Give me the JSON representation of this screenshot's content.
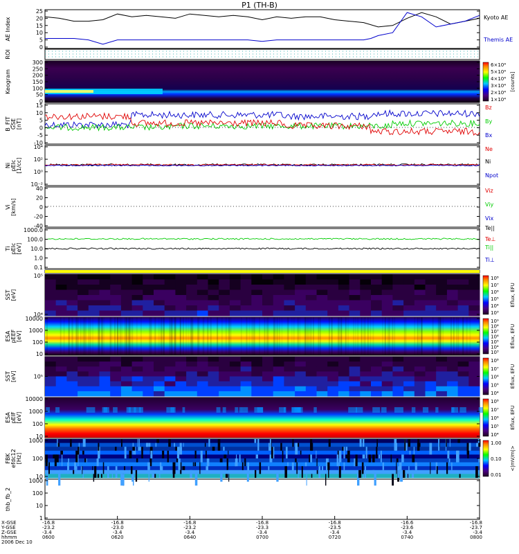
{
  "title": "P1 (TH-B)",
  "colors": {
    "black": "#000000",
    "blue": "#0000cc",
    "red": "#e00000",
    "green": "#00cc00",
    "yellow": "#ffff00",
    "cyan": "#00a0a0",
    "dark_bg": "#1a0020"
  },
  "chart_data": [
    {
      "type": "line",
      "panel": "ae",
      "ylabel": "AE Index",
      "ylim": [
        0,
        25
      ],
      "yticks": [
        "25",
        "20",
        "15",
        "10",
        "5",
        "0"
      ],
      "series": [
        {
          "name": "Kyoto AE",
          "color": "#000000",
          "x": [
            0,
            4,
            8,
            12,
            16,
            20,
            24,
            28,
            32,
            36,
            40,
            44,
            48,
            52,
            56,
            60,
            64,
            68,
            72,
            76,
            80,
            84,
            88,
            92,
            96,
            100,
            104,
            108,
            112,
            116,
            120
          ],
          "y": [
            21,
            20,
            18,
            18,
            19,
            23,
            21,
            22,
            21,
            20,
            23,
            22,
            21,
            22,
            21,
            19,
            21,
            20,
            21,
            21,
            19,
            18,
            17,
            14,
            15,
            20,
            24,
            21,
            16,
            18,
            20
          ]
        },
        {
          "name": "Themis AE",
          "color": "#0000cc",
          "x": [
            0,
            4,
            8,
            12,
            16,
            20,
            24,
            28,
            32,
            36,
            40,
            44,
            48,
            52,
            56,
            60,
            64,
            68,
            72,
            76,
            80,
            84,
            88,
            90,
            92,
            96,
            100,
            104,
            108,
            112,
            116,
            120
          ],
          "y": [
            6,
            6,
            6,
            5,
            2,
            5,
            5,
            5,
            5,
            5,
            5,
            5,
            5,
            5,
            5,
            4,
            5,
            5,
            5,
            5,
            5,
            5,
            5,
            6,
            8,
            10,
            24,
            21,
            14,
            16,
            18,
            22
          ]
        }
      ]
    },
    {
      "type": "line",
      "panel": "roi",
      "ylabel": "ROI"
    },
    {
      "type": "heatmap",
      "panel": "keogram",
      "ylabel": "Keogram",
      "ylim": [
        0,
        300
      ],
      "yticks": [
        "300",
        "250",
        "200",
        "150",
        "100",
        "50",
        "0"
      ],
      "colorbar_ticks": [
        "6×10⁴",
        "5×10⁴",
        "4×10⁴",
        "3×10⁴",
        "2×10⁴",
        "1×10⁴"
      ],
      "colorbar_label": "[counts]"
    },
    {
      "type": "line",
      "panel": "bfield",
      "ylabel": "B_FIT",
      "ylabel2": "GSE",
      "ylabel3": "[nT]",
      "ylim": [
        -10,
        15
      ],
      "yticks": [
        "15",
        "10",
        "5",
        "0",
        "-5",
        "-10"
      ],
      "series": [
        {
          "name": "Bz",
          "color": "#e00000"
        },
        {
          "name": "By",
          "color": "#00cc00"
        },
        {
          "name": "Bx",
          "color": "#0000cc"
        }
      ]
    },
    {
      "type": "line",
      "panel": "density",
      "ylabel": "Ni",
      "ylabel2": "pEIc",
      "ylabel3": "[1/cc]",
      "yticks": [
        "10⁴",
        "10²",
        "10⁰",
        "10⁻²"
      ],
      "series": [
        {
          "name": "Ne",
          "color": "#e00000"
        },
        {
          "name": "Ni",
          "color": "#000000"
        },
        {
          "name": "Npot",
          "color": "#0000cc"
        }
      ]
    },
    {
      "type": "line",
      "panel": "velocity",
      "ylabel": "Vi",
      "ylabel2": "[km/s]",
      "ylim": [
        -50,
        50
      ],
      "yticks": [
        "40",
        "20",
        "0",
        "-20",
        "-40"
      ],
      "series": [
        {
          "name": "Viz",
          "color": "#e00000"
        },
        {
          "name": "Viy",
          "color": "#00cc00"
        },
        {
          "name": "Vix",
          "color": "#0000cc"
        }
      ]
    },
    {
      "type": "line",
      "panel": "temperature",
      "ylabel": "Ti",
      "ylabel2": "pEIc",
      "ylabel3": "[eV]",
      "yticks": [
        "1000.0",
        "100.0",
        "10.0",
        "1.0",
        "0.1"
      ],
      "series": [
        {
          "name": "Te||",
          "color": "#000000"
        },
        {
          "name": "Te⊥",
          "color": "#e00000"
        },
        {
          "name": "Ti||",
          "color": "#00cc00"
        },
        {
          "name": "Ti⊥",
          "color": "#0000cc"
        }
      ]
    },
    {
      "type": "heatmap",
      "panel": "sst_e",
      "ylabel": "SST",
      "ylabel2": "[eV]",
      "yticks": [
        "10⁵",
        "10⁴"
      ],
      "colorbar_ticks": [
        "10⁸",
        "10⁷",
        "10⁶",
        "10⁵",
        "10⁴",
        "10³"
      ],
      "colorbar_label": "Eflux, EFU"
    },
    {
      "type": "heatmap",
      "panel": "esa_e",
      "ylabel": "ESA",
      "ylabel2": "pEEF",
      "ylabel3": "[eV]",
      "yticks": [
        "10000",
        "1000",
        "100",
        "10"
      ],
      "colorbar_ticks": [
        "10⁹",
        "10⁸",
        "10⁷",
        "10⁶",
        "10⁵",
        "10⁴",
        "10³"
      ],
      "colorbar_label": "Eflux, EFU"
    },
    {
      "type": "heatmap",
      "panel": "sst_i",
      "ylabel": "SST",
      "ylabel2": "[eV]",
      "yticks": [
        "10⁵"
      ],
      "colorbar_ticks": [
        "10⁸",
        "10⁷",
        "10⁶",
        "10⁵",
        "10⁴"
      ],
      "colorbar_label": "Eflux, EFU"
    },
    {
      "type": "heatmap",
      "panel": "esa_i",
      "ylabel": "ESA",
      "ylabel2": "pEIF",
      "ylabel3": "[eV]",
      "yticks": [
        "10000",
        "1000",
        "100",
        "10"
      ],
      "colorbar_ticks": [
        "10⁸",
        "10⁷",
        "10⁶",
        "10⁵",
        "10⁴"
      ],
      "colorbar_label": "Eflux, EFU"
    },
    {
      "type": "heatmap",
      "panel": "fbk",
      "ylabel": "FBK",
      "ylabel2": "efdc12",
      "ylabel3": "[Hz]",
      "yticks": [
        "1000",
        "100",
        "10"
      ],
      "colorbar_ticks": [
        "1.00",
        "0.10",
        "0.01"
      ],
      "colorbar_label": "<|mV/m|>"
    },
    {
      "type": "line",
      "panel": "thb_fb",
      "ylabel": "thb_fb_2",
      "yticks": [
        "1000",
        "100",
        "10",
        "1"
      ]
    }
  ],
  "legend_right": {
    "ae": [
      "Kyoto AE",
      "Themis AE"
    ]
  },
  "xaxis": {
    "row_labels": [
      "X-GSE",
      "Y-GSE",
      "Z-GSE",
      "hhmm",
      "2006 Dec 10"
    ],
    "ticks": [
      {
        "x": "-16.8",
        "y": "-23.2",
        "z": "-3.4",
        "t": "0600"
      },
      {
        "x": "-16.8",
        "y": "-23.0",
        "z": "-3.4",
        "t": "0620"
      },
      {
        "x": "-16.8",
        "y": "-23.2",
        "z": "-3.4",
        "t": "0640"
      },
      {
        "x": "-16.8",
        "y": "-23.3",
        "z": "-3.4",
        "t": "0700"
      },
      {
        "x": "-16.8",
        "y": "-23.5",
        "z": "-3.4",
        "t": "0720"
      },
      {
        "x": "-16.6",
        "y": "-23.6",
        "z": "-3.4",
        "t": "0740"
      },
      {
        "x": "-16.8",
        "y": "-23.7",
        "z": "-3.4",
        "t": "0800"
      }
    ]
  }
}
